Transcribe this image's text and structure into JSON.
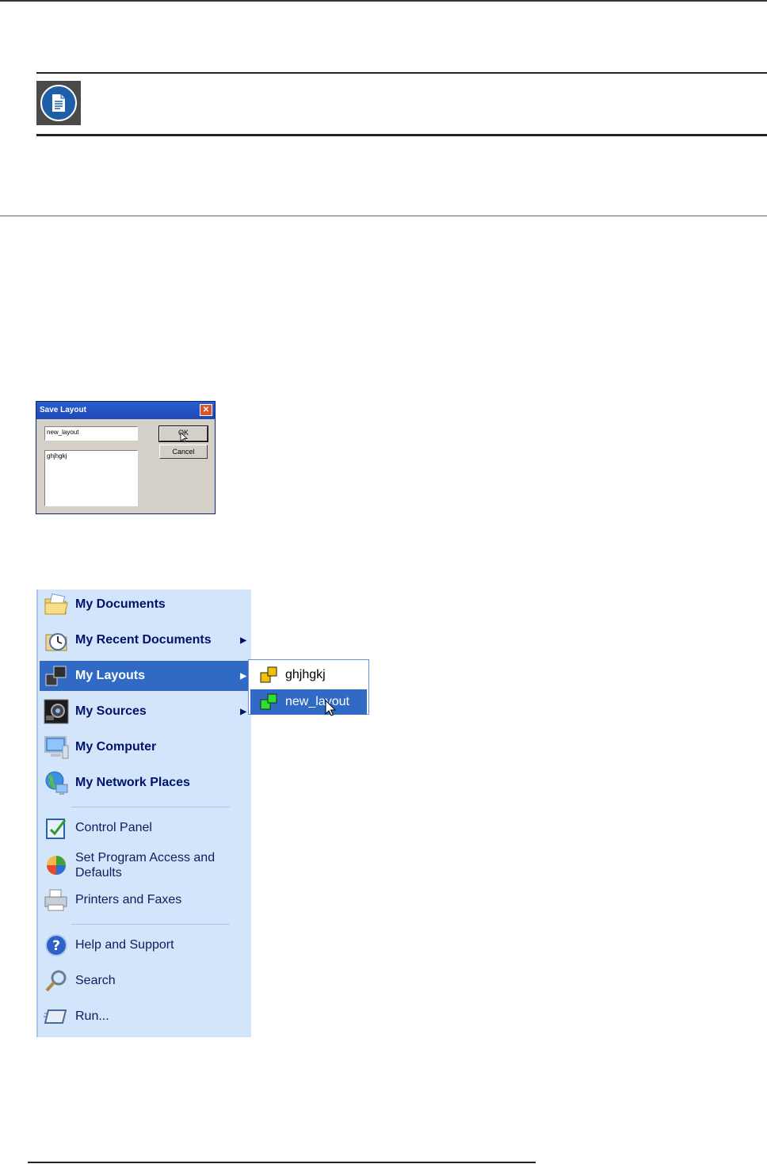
{
  "save_dialog": {
    "title": "Save Layout",
    "name_value": "new_layout",
    "list_items": [
      "ghjhgkj"
    ],
    "ok_label": "OK",
    "cancel_label": "Cancel"
  },
  "start_menu": {
    "items": [
      {
        "label": "My Documents",
        "icon": "folder-documents-icon",
        "submenu": false
      },
      {
        "label": "My Recent Documents",
        "icon": "recent-documents-icon",
        "submenu": true
      },
      {
        "label": "My Layouts",
        "icon": "layouts-icon",
        "submenu": true
      },
      {
        "label": "My Sources",
        "icon": "sources-icon",
        "submenu": true
      },
      {
        "label": "My Computer",
        "icon": "computer-icon",
        "submenu": false
      },
      {
        "label": "My Network Places",
        "icon": "network-places-icon",
        "submenu": false
      }
    ],
    "system_items": [
      {
        "label": "Control Panel",
        "icon": "control-panel-icon"
      },
      {
        "label": "Set Program Access and Defaults",
        "icon": "program-access-icon"
      },
      {
        "label": "Printers and Faxes",
        "icon": "printer-icon"
      }
    ],
    "help_items": [
      {
        "label": "Help and Support",
        "icon": "help-icon"
      },
      {
        "label": "Search",
        "icon": "search-icon"
      },
      {
        "label": "Run...",
        "icon": "run-icon"
      }
    ],
    "selected_item": "My Layouts"
  },
  "layouts_submenu": {
    "items": [
      "ghjhgkj",
      "new_layout"
    ],
    "selected": "new_layout"
  },
  "colors": {
    "menu_background": "#d3e5fa",
    "selection": "#316ac5",
    "menu_text": "#00136b"
  }
}
